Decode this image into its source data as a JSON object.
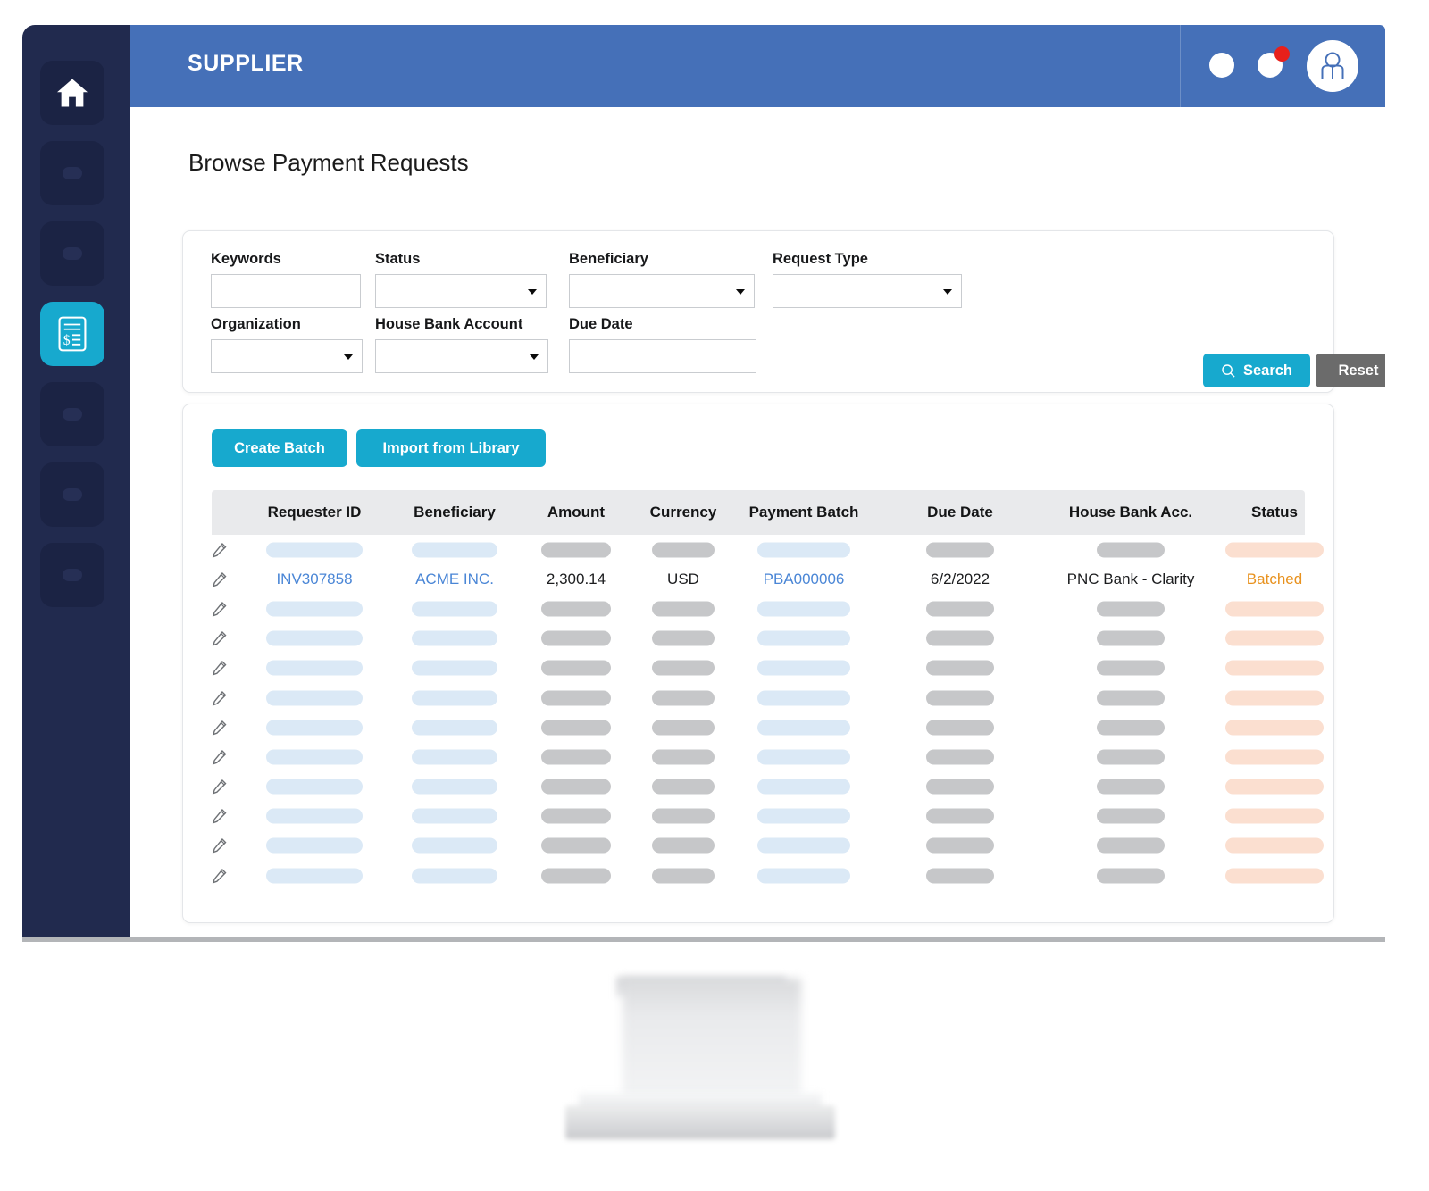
{
  "app": {
    "title": "SUPPLIER",
    "header_color": "#4570B8",
    "sidebar_color": "#212A4E",
    "accent_color": "#17A9CE"
  },
  "topbar": {
    "icons": [
      {
        "name": "circle-icon-1",
        "badge": false
      },
      {
        "name": "circle-icon-2",
        "badge": true
      }
    ],
    "avatar_label": "user-avatar"
  },
  "sidebar": {
    "items": [
      {
        "name": "home",
        "icon": "home-icon",
        "active": false
      },
      {
        "name": "nav-placeholder-1",
        "icon": "dot-icon",
        "active": false
      },
      {
        "name": "nav-placeholder-2",
        "icon": "dot-icon",
        "active": false
      },
      {
        "name": "payment-requests",
        "icon": "invoice-icon",
        "active": true
      },
      {
        "name": "nav-placeholder-3",
        "icon": "dot-icon",
        "active": false
      },
      {
        "name": "nav-placeholder-4",
        "icon": "dot-icon",
        "active": false
      },
      {
        "name": "nav-placeholder-5",
        "icon": "dot-icon",
        "active": false
      }
    ]
  },
  "page": {
    "title": "Browse Payment Requests"
  },
  "filters": {
    "fields": [
      {
        "id": "keywords",
        "label": "Keywords",
        "type": "text",
        "value": "",
        "placeholder": ""
      },
      {
        "id": "status",
        "label": "Status",
        "type": "select",
        "value": "",
        "placeholder": ""
      },
      {
        "id": "beneficiary",
        "label": "Beneficiary",
        "type": "select",
        "value": "",
        "placeholder": ""
      },
      {
        "id": "request_type",
        "label": "Request Type",
        "type": "select",
        "value": "",
        "placeholder": ""
      },
      {
        "id": "organization",
        "label": "Organization",
        "type": "select",
        "value": "",
        "placeholder": ""
      },
      {
        "id": "house_bank_account",
        "label": "House Bank Account",
        "type": "select",
        "value": "",
        "placeholder": ""
      },
      {
        "id": "due_date",
        "label": "Due Date",
        "type": "text",
        "value": "",
        "placeholder": ""
      }
    ],
    "search_label": "Search",
    "search_icon": "search-icon",
    "reset_label": "Reset"
  },
  "toolbar": {
    "create_batch_label": "Create Batch",
    "import_library_label": "Import from Library"
  },
  "table": {
    "columns": [
      "Requester ID",
      "Beneficiary",
      "Amount",
      "Currency",
      "Payment Batch",
      "Due Date",
      "House Bank Acc.",
      "Status"
    ],
    "rows": [
      {
        "loaded": false,
        "cells": [
          "",
          "",
          "",
          "",
          "",
          "",
          "",
          ""
        ]
      },
      {
        "loaded": true,
        "cells": [
          "INV307858",
          "ACME INC.",
          "2,300.14",
          "USD",
          "PBA000006",
          "6/2/2022",
          "PNC Bank - Clarity",
          "Batched"
        ]
      },
      {
        "loaded": false,
        "cells": [
          "",
          "",
          "",
          "",
          "",
          "",
          "",
          ""
        ]
      },
      {
        "loaded": false,
        "cells": [
          "",
          "",
          "",
          "",
          "",
          "",
          "",
          ""
        ]
      },
      {
        "loaded": false,
        "cells": [
          "",
          "",
          "",
          "",
          "",
          "",
          "",
          ""
        ]
      },
      {
        "loaded": false,
        "cells": [
          "",
          "",
          "",
          "",
          "",
          "",
          "",
          ""
        ]
      },
      {
        "loaded": false,
        "cells": [
          "",
          "",
          "",
          "",
          "",
          "",
          "",
          ""
        ]
      },
      {
        "loaded": false,
        "cells": [
          "",
          "",
          "",
          "",
          "",
          "",
          "",
          ""
        ]
      },
      {
        "loaded": false,
        "cells": [
          "",
          "",
          "",
          "",
          "",
          "",
          "",
          ""
        ]
      },
      {
        "loaded": false,
        "cells": [
          "",
          "",
          "",
          "",
          "",
          "",
          "",
          ""
        ]
      },
      {
        "loaded": false,
        "cells": [
          "",
          "",
          "",
          "",
          "",
          "",
          "",
          ""
        ]
      },
      {
        "loaded": false,
        "cells": [
          "",
          "",
          "",
          "",
          "",
          "",
          "",
          ""
        ]
      }
    ],
    "row_action_icon": "edit-pencil-icon",
    "link_color": "#4A86D6",
    "status_color": "#E8921F"
  },
  "layout": {
    "column_centers": [
      115,
      272,
      408,
      528,
      663,
      838,
      1029,
      1190
    ],
    "skeleton_widths": [
      108,
      96,
      78,
      70,
      104,
      76,
      76,
      110
    ],
    "skeleton_kinds": [
      "blue",
      "blue",
      "gray",
      "gray",
      "blue",
      "gray",
      "gray",
      "peach"
    ]
  }
}
